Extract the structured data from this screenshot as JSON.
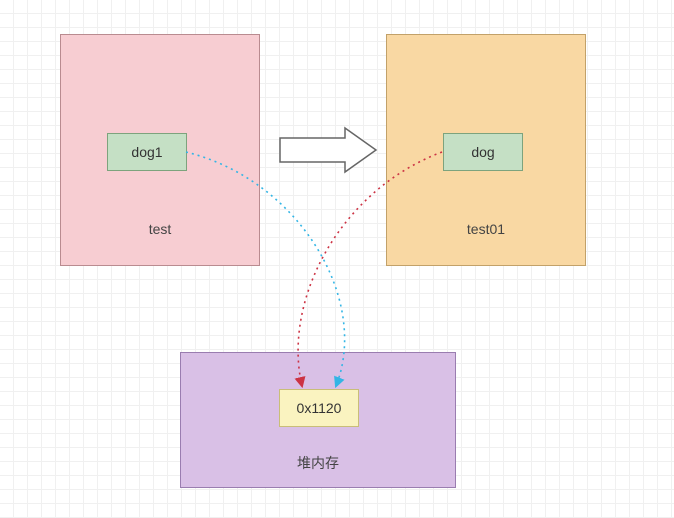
{
  "boxes": {
    "left": {
      "label": "test",
      "inner": "dog1"
    },
    "right": {
      "label": "test01",
      "inner": "dog"
    },
    "bottom": {
      "label": "堆内存",
      "inner": "0x1120"
    }
  },
  "colors": {
    "pink": "#f7cdd2",
    "orange": "#f9d8a3",
    "purple": "#d9c0e6",
    "green": "#c5e0c5",
    "yellow": "#faf3c0",
    "blueDash": "#33b5e5",
    "redDash": "#cc3344"
  }
}
